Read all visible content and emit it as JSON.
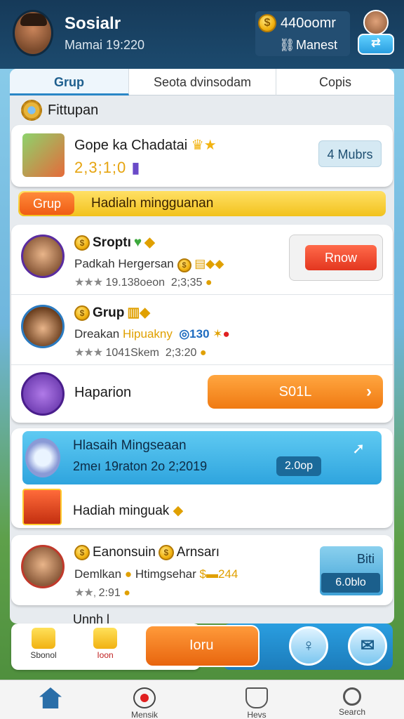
{
  "header": {
    "title": "Sosialr",
    "subtitle": "Mamai 19:220",
    "wallet_amount": "440oomr",
    "wallet_label": "Manest",
    "profile_button": "⇄"
  },
  "tabs": [
    {
      "label": "Grup"
    },
    {
      "label": "Seota dvinsodam"
    },
    {
      "label": "Copis"
    }
  ],
  "section_title": "Fittupan",
  "group": {
    "name": "Gope ka Chadatai",
    "code": "2,3;1;0",
    "members": "4 Mubrs"
  },
  "banner": {
    "pill": "Grup",
    "text": "Hadialn mingguanan"
  },
  "players": [
    {
      "name": "Sroptı",
      "line": "Padkah Hergersan",
      "meta": "19.138oeon",
      "time": "2;3;35",
      "button": "Rnow"
    },
    {
      "name": "Grup",
      "line_a": "Dreakan",
      "line_b": "Hipuakny",
      "score": "130",
      "meta": "1041Skem",
      "time": "2;3:20"
    },
    {
      "name": "Haparion",
      "button": "S01L"
    }
  ],
  "reward": {
    "title": "Hlasaih Mingseaan",
    "subtitle": "2meı 19raton 2o 2;2019",
    "badge": "2.0op",
    "gift_label": "Hadiah minguak"
  },
  "friend": {
    "name_a": "Eanonsuin",
    "name_b": "Arnsarı",
    "line_a": "Demlkan",
    "line_b": "Htimgsehar",
    "amount": "244",
    "meta": "2:91",
    "badge_top": "Biti",
    "badge_bottom": "6.0blo"
  },
  "peek_row": "Unnh l",
  "dock": {
    "item1": "Sbonol",
    "item2": "Ioon",
    "main": "Ioru"
  },
  "bottom_nav": [
    {
      "label": ""
    },
    {
      "label": "Mensik"
    },
    {
      "label": "Hevs"
    },
    {
      "label": "Search"
    }
  ]
}
